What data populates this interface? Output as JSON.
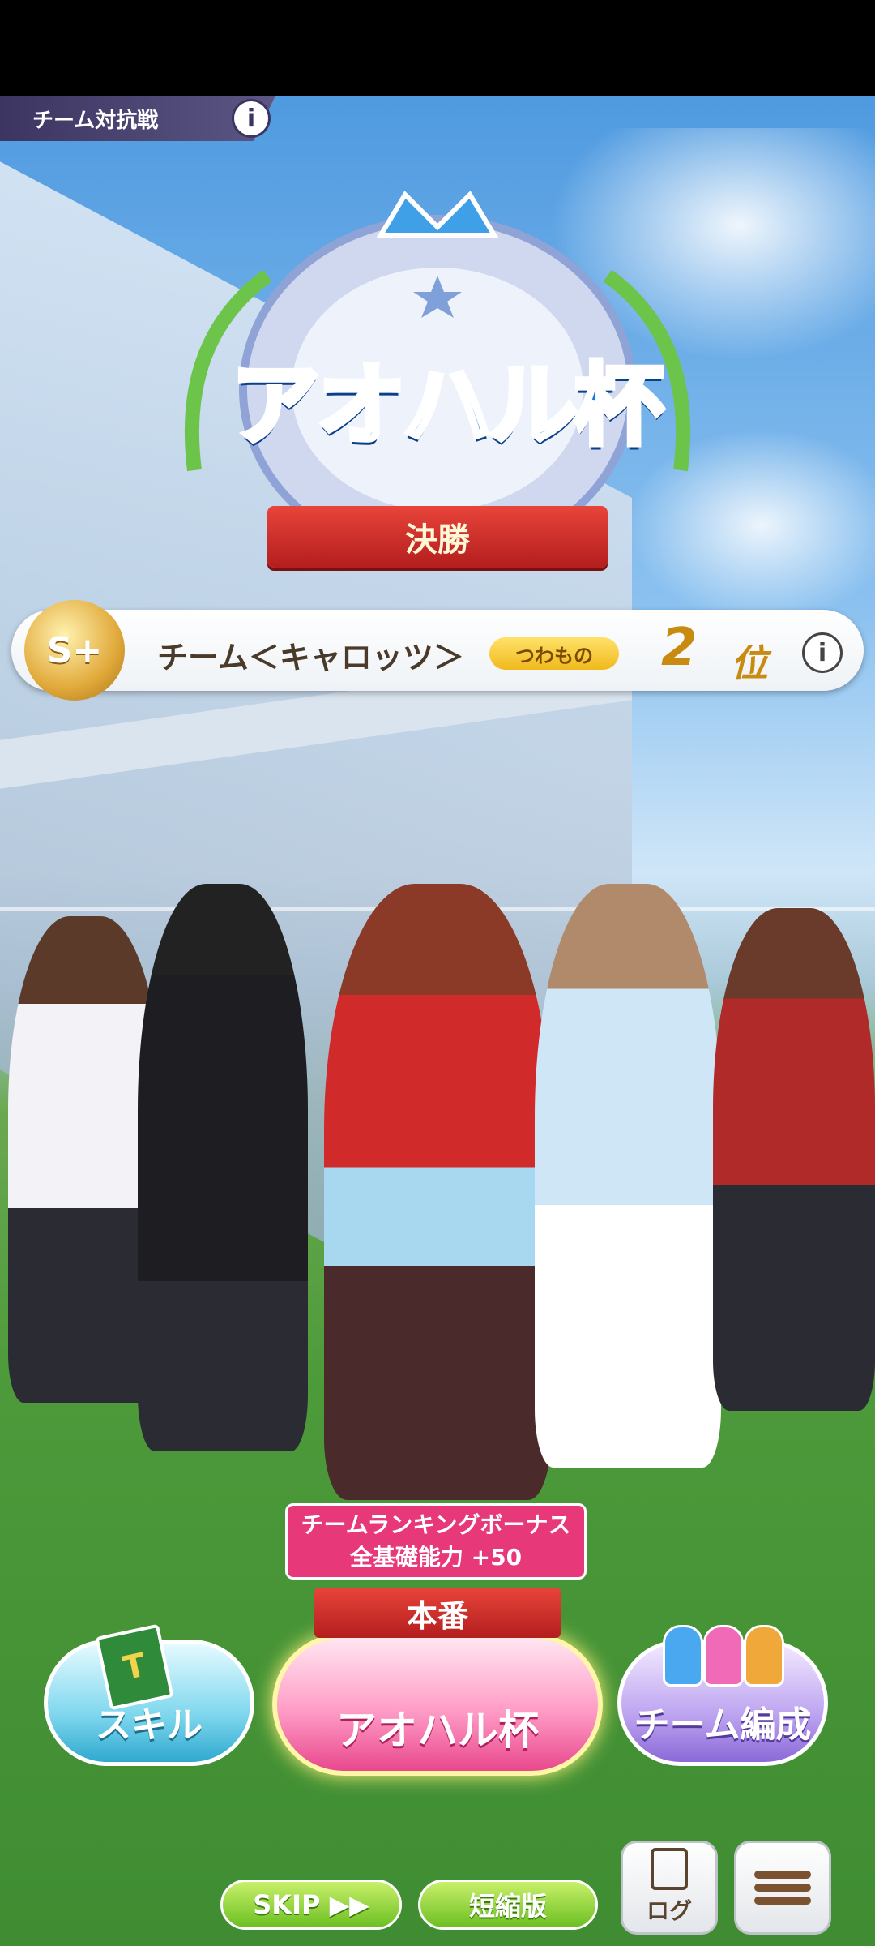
{
  "header": {
    "mode_label": "チーム対抗戦",
    "info_label": "i"
  },
  "event": {
    "logo_text": "アオハル杯",
    "stage": "決勝"
  },
  "team": {
    "rank_medal": "S+",
    "name": "チーム＜キャロッツ＞",
    "class_tag": "つわもの",
    "rank_number": "2",
    "rank_unit": "位",
    "info_label": "i"
  },
  "bonus": {
    "line1": "チームランキングボーナス",
    "line2": "全基礎能力 +50"
  },
  "actions": {
    "race_type": "本番",
    "skill_label": "スキル",
    "main_label": "アオハル杯",
    "team_label": "チーム編成",
    "skip_label": "SKIP ▶▶",
    "short_label": "短縮版",
    "log_label": "ログ"
  },
  "colors": {
    "accent_red": "#c9262a",
    "accent_pink": "#e7387a",
    "accent_gold": "#c98a10"
  }
}
